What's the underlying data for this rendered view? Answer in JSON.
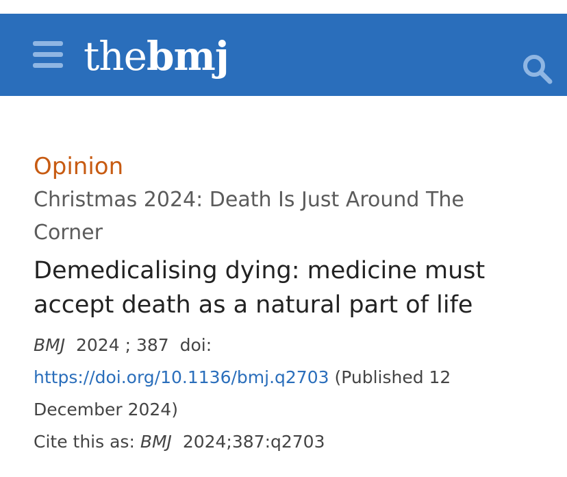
{
  "header": {
    "logo_the": "the",
    "logo_bmj": "bmj",
    "menu_icon": "hamburger-menu-icon",
    "search_icon": "search-icon",
    "bg_color": "#2a6ebb"
  },
  "article": {
    "section": "Opinion",
    "series": "Christmas 2024: Death Is Just Around The Corner",
    "title": "Demedicalising dying: medicine must accept death as a natural part of life",
    "journal": "BMJ",
    "year": "2024",
    "volume_sep": " ; ",
    "volume": "387",
    "doi_label": "doi:",
    "doi_url": "https://doi.org/10.1136/bmj.q2703",
    "published": "(Published 12 December 2024)",
    "cite_label": "Cite this as: ",
    "cite_journal": "BMJ",
    "cite_ref": "2024;387:q2703"
  }
}
